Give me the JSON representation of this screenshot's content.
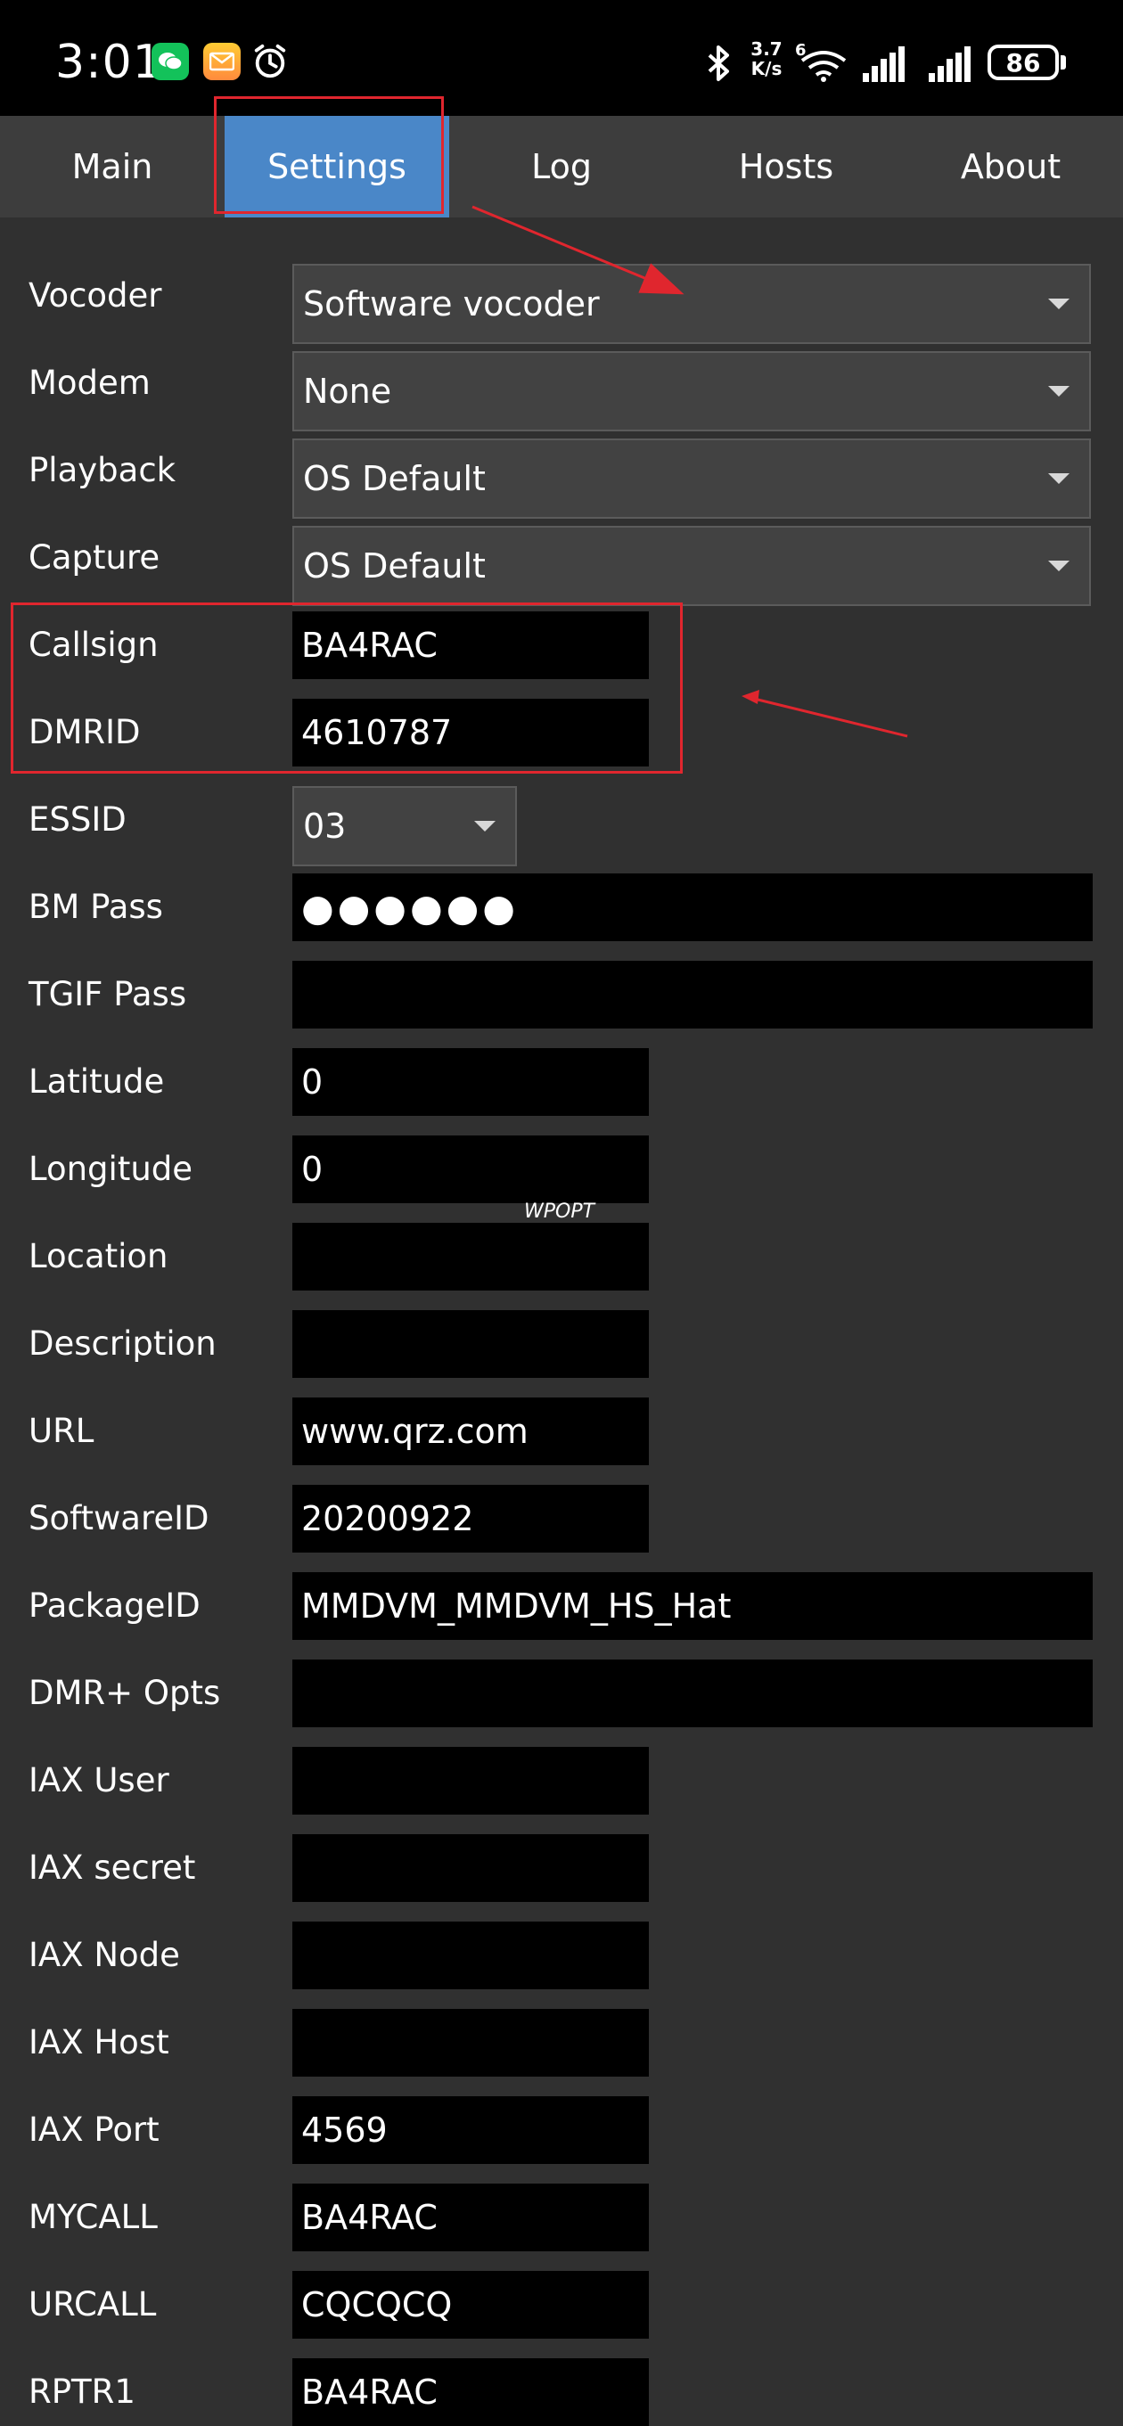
{
  "status_bar": {
    "time": "3:01",
    "speed_value": "3.7",
    "speed_unit": "K/s",
    "network": "6",
    "battery": "86"
  },
  "tabs": [
    {
      "label": "Main",
      "active": false
    },
    {
      "label": "Settings",
      "active": true
    },
    {
      "label": "Log",
      "active": false
    },
    {
      "label": "Hosts",
      "active": false
    },
    {
      "label": "About",
      "active": false
    }
  ],
  "form": {
    "vocoder": {
      "label": "Vocoder",
      "value": "Software vocoder"
    },
    "modem": {
      "label": "Modem",
      "value": "None"
    },
    "playback": {
      "label": "Playback",
      "value": "OS Default"
    },
    "capture": {
      "label": "Capture",
      "value": "OS Default"
    },
    "callsign": {
      "label": "Callsign",
      "value": "BA4RAC"
    },
    "dmrid": {
      "label": "DMRID",
      "value": "4610787"
    },
    "essid": {
      "label": "ESSID",
      "value": "03"
    },
    "bm_pass": {
      "label": "BM Pass",
      "value": "●●●●●●"
    },
    "tgif_pass": {
      "label": "TGIF Pass",
      "value": ""
    },
    "latitude": {
      "label": "Latitude",
      "value": "0"
    },
    "longitude": {
      "label": "Longitude",
      "value": "0"
    },
    "location": {
      "label": "Location",
      "value": ""
    },
    "description": {
      "label": "Description",
      "value": ""
    },
    "url": {
      "label": "URL",
      "value": "www.qrz.com"
    },
    "software_id": {
      "label": "SoftwareID",
      "value": "20200922"
    },
    "package_id": {
      "label": "PackageID",
      "value": "MMDVM_MMDVM_HS_Hat"
    },
    "dmr_opts": {
      "label": "DMR+ Opts",
      "value": ""
    },
    "iax_user": {
      "label": "IAX User",
      "value": ""
    },
    "iax_secret": {
      "label": "IAX secret",
      "value": ""
    },
    "iax_node": {
      "label": "IAX Node",
      "value": ""
    },
    "iax_host": {
      "label": "IAX Host",
      "value": ""
    },
    "iax_port": {
      "label": "IAX Port",
      "value": "4569"
    },
    "mycall": {
      "label": "MYCALL",
      "value": "BA4RAC"
    },
    "urcall": {
      "label": "URCALL",
      "value": "CQCQCQ"
    },
    "rptr1": {
      "label": "RPTR1",
      "value": "BA4RAC"
    }
  },
  "watermark": "WPOPT",
  "colors": {
    "background": "#303030",
    "tab_bar": "#3d3d3d",
    "tab_active": "#4a87c8",
    "annotation": "#e0262e"
  }
}
